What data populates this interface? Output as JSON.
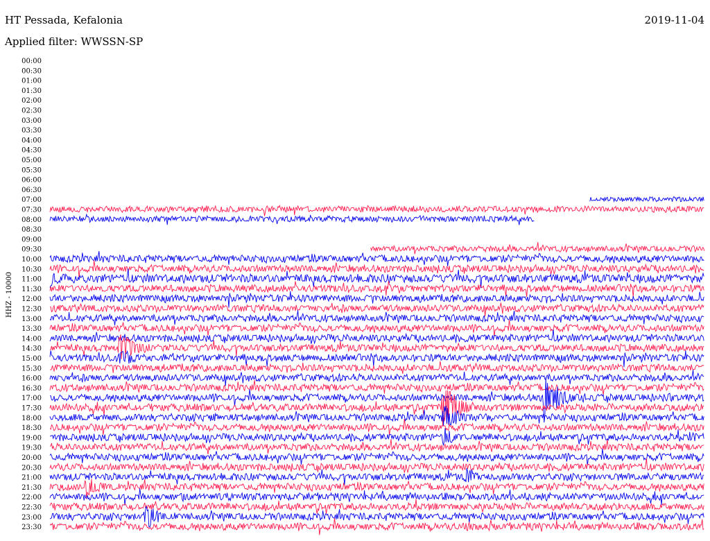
{
  "header": {
    "station": "HT Pessada, Kefalonia",
    "date": "2019-11-04",
    "filter": "Applied filter: WWSSN-SP"
  },
  "chart_data": {
    "type": "line",
    "subtype": "helicorder",
    "ylabel": "HHZ - 10000",
    "row_labels": [
      "00:00",
      "00:30",
      "01:00",
      "01:30",
      "02:00",
      "02:30",
      "03:00",
      "03:30",
      "04:00",
      "04:30",
      "05:00",
      "05:30",
      "06:00",
      "06:30",
      "07:00",
      "07:30",
      "08:00",
      "08:30",
      "09:00",
      "09:30",
      "10:00",
      "10:30",
      "11:00",
      "11:30",
      "12:00",
      "12:30",
      "13:00",
      "13:30",
      "14:00",
      "14:30",
      "15:00",
      "15:30",
      "16:00",
      "16:30",
      "17:00",
      "17:30",
      "18:00",
      "18:30",
      "19:00",
      "19:30",
      "20:00",
      "20:30",
      "21:00",
      "21:30",
      "22:00",
      "22:30",
      "23:00",
      "23:30"
    ],
    "x_range_minutes": [
      0,
      30
    ],
    "colors": {
      "a": "#0000ee",
      "b": "#ff1a4d"
    },
    "traces": [
      {
        "row": "07:00",
        "start": 0.825,
        "end": 1.0,
        "amp": 4
      },
      {
        "row": "07:30",
        "start": 0.0,
        "end": 1.0,
        "amp": 5
      },
      {
        "row": "08:00",
        "start": 0.0,
        "end": 0.74,
        "amp": 5
      },
      {
        "row": "09:30",
        "start": 0.49,
        "end": 1.0,
        "amp": 5
      },
      {
        "row": "10:00",
        "start": 0.0,
        "end": 1.0,
        "amp": 6
      },
      {
        "row": "10:30",
        "start": 0.0,
        "end": 1.0,
        "amp": 6
      },
      {
        "row": "11:00",
        "start": 0.0,
        "end": 1.0,
        "amp": 7
      },
      {
        "row": "11:30",
        "start": 0.0,
        "end": 1.0,
        "amp": 6
      },
      {
        "row": "12:00",
        "start": 0.0,
        "end": 1.0,
        "amp": 6
      },
      {
        "row": "12:30",
        "start": 0.0,
        "end": 1.0,
        "amp": 6
      },
      {
        "row": "13:00",
        "start": 0.0,
        "end": 1.0,
        "amp": 6
      },
      {
        "row": "13:30",
        "start": 0.0,
        "end": 1.0,
        "amp": 6
      },
      {
        "row": "14:00",
        "start": 0.0,
        "end": 1.0,
        "amp": 6
      },
      {
        "row": "14:30",
        "start": 0.0,
        "end": 1.0,
        "amp": 6
      },
      {
        "row": "15:00",
        "start": 0.0,
        "end": 1.0,
        "amp": 6
      },
      {
        "row": "15:30",
        "start": 0.0,
        "end": 1.0,
        "amp": 6
      },
      {
        "row": "16:00",
        "start": 0.0,
        "end": 1.0,
        "amp": 6
      },
      {
        "row": "16:30",
        "start": 0.0,
        "end": 1.0,
        "amp": 6
      },
      {
        "row": "17:00",
        "start": 0.0,
        "end": 1.0,
        "amp": 6
      },
      {
        "row": "17:30",
        "start": 0.0,
        "end": 1.0,
        "amp": 6
      },
      {
        "row": "18:00",
        "start": 0.0,
        "end": 1.0,
        "amp": 6
      },
      {
        "row": "18:30",
        "start": 0.0,
        "end": 1.0,
        "amp": 6
      },
      {
        "row": "19:00",
        "start": 0.0,
        "end": 1.0,
        "amp": 6
      },
      {
        "row": "19:30",
        "start": 0.0,
        "end": 1.0,
        "amp": 6
      },
      {
        "row": "20:00",
        "start": 0.0,
        "end": 1.0,
        "amp": 6
      },
      {
        "row": "20:30",
        "start": 0.0,
        "end": 1.0,
        "amp": 6
      },
      {
        "row": "21:00",
        "start": 0.0,
        "end": 1.0,
        "amp": 6
      },
      {
        "row": "21:30",
        "start": 0.0,
        "end": 1.0,
        "amp": 6
      },
      {
        "row": "22:00",
        "start": 0.0,
        "end": 1.0,
        "amp": 6
      },
      {
        "row": "22:30",
        "start": 0.0,
        "end": 1.0,
        "amp": 6
      },
      {
        "row": "23:00",
        "start": 0.0,
        "end": 1.0,
        "amp": 6
      },
      {
        "row": "23:30",
        "start": 0.0,
        "end": 1.0,
        "amp": 6
      }
    ],
    "events": [
      {
        "row": "11:00",
        "at": 0.0,
        "amp": 14,
        "dur": 0.02
      },
      {
        "row": "14:30",
        "at": 0.105,
        "amp": 28,
        "dur": 0.03
      },
      {
        "row": "15:00",
        "at": 0.105,
        "amp": 16,
        "dur": 0.03
      },
      {
        "row": "17:00",
        "at": 0.755,
        "amp": 40,
        "dur": 0.025
      },
      {
        "row": "17:30",
        "at": 0.6,
        "amp": 40,
        "dur": 0.03
      },
      {
        "row": "18:00",
        "at": 0.6,
        "amp": 22,
        "dur": 0.03
      },
      {
        "row": "18:00",
        "at": 0.245,
        "amp": 10,
        "dur": 0.015
      },
      {
        "row": "19:00",
        "at": 0.6,
        "amp": 18,
        "dur": 0.02
      },
      {
        "row": "21:00",
        "at": 0.635,
        "amp": 18,
        "dur": 0.02
      },
      {
        "row": "21:30",
        "at": 0.055,
        "amp": 22,
        "dur": 0.02
      },
      {
        "row": "22:00",
        "at": 0.2,
        "amp": 10,
        "dur": 0.015
      },
      {
        "row": "23:00",
        "at": 0.145,
        "amp": 28,
        "dur": 0.02
      },
      {
        "row": "23:30",
        "at": 0.635,
        "amp": 12,
        "dur": 0.02
      },
      {
        "row": "19:00",
        "at": 0.975,
        "amp": 10,
        "dur": 0.02
      },
      {
        "row": "17:00",
        "at": 0.945,
        "amp": 8,
        "dur": 0.015
      }
    ]
  }
}
